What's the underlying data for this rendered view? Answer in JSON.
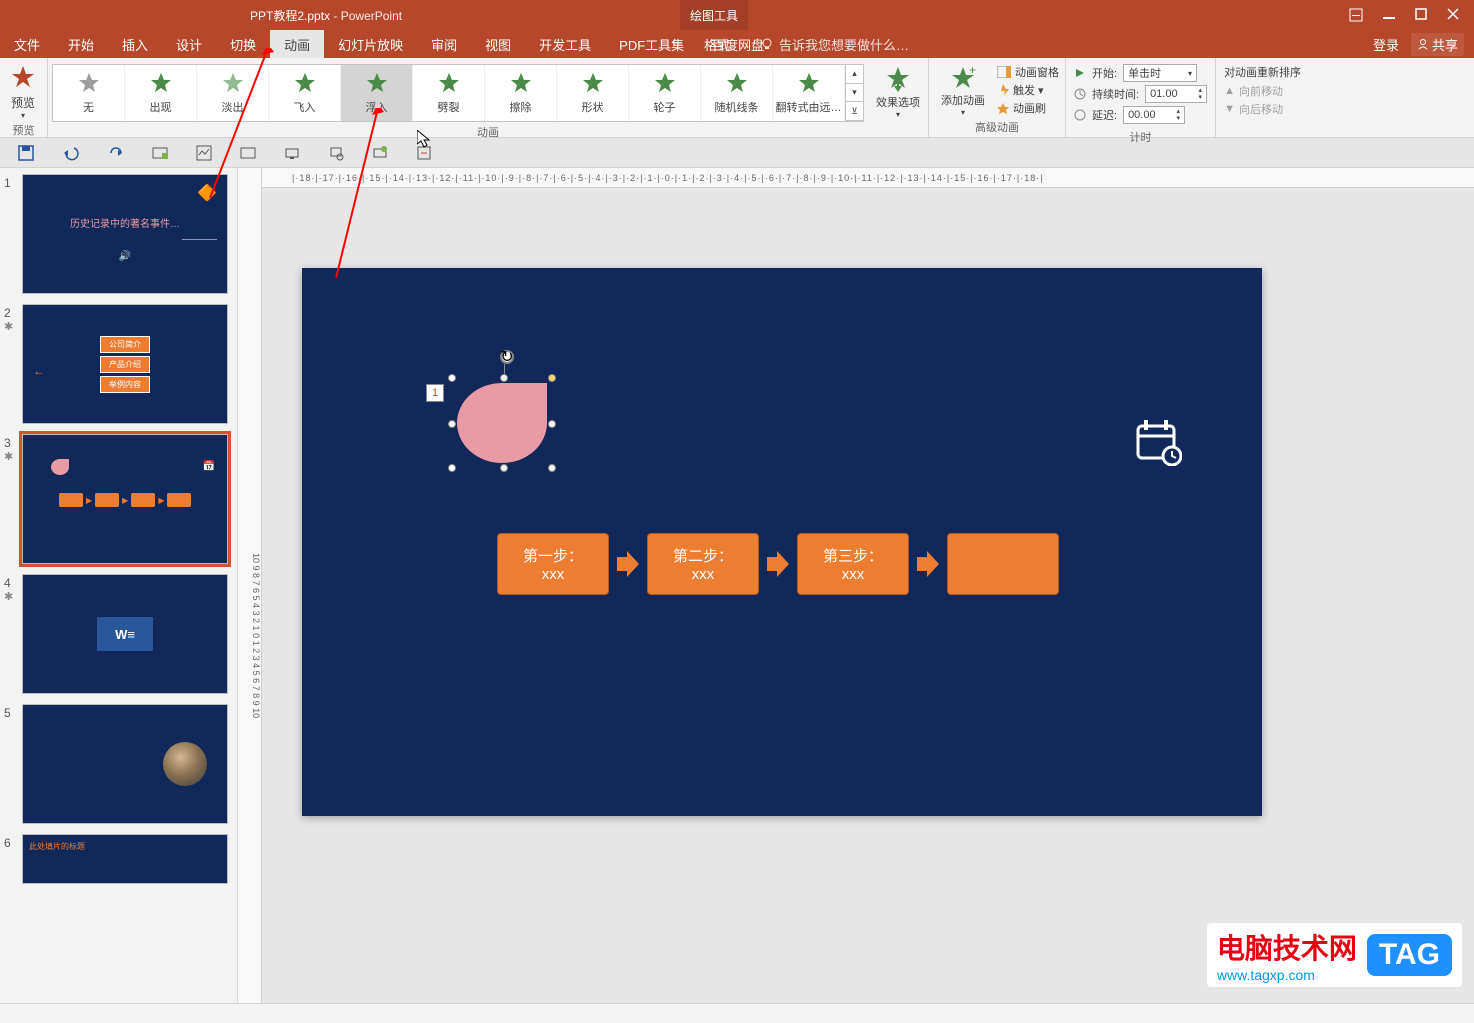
{
  "title": {
    "doc": "PPT教程2.pptx",
    "app": "PowerPoint",
    "drawing_tools": "绘图工具"
  },
  "win": {
    "login": "登录",
    "share": "共享"
  },
  "tabs": {
    "file": "文件",
    "home": "开始",
    "insert": "插入",
    "design": "设计",
    "transition": "切换",
    "animation": "动画",
    "slideshow": "幻灯片放映",
    "review": "审阅",
    "view": "视图",
    "developer": "开发工具",
    "pdf": "PDF工具集",
    "baidu": "百度网盘",
    "format": "格式",
    "tellme": "告诉我您想要做什么…"
  },
  "ribbon": {
    "preview": "预览",
    "preview_group": "预览",
    "anim_group": "动画",
    "anims": {
      "none": "无",
      "appear": "出现",
      "fade": "淡出",
      "flyin": "飞入",
      "floatin": "浮入",
      "split": "劈裂",
      "wipe": "擦除",
      "shape": "形状",
      "wheel": "轮子",
      "random": "随机线条",
      "flip": "翻转式由远…"
    },
    "effect_options": "效果选项",
    "adv_group": "高级动画",
    "add_anim": "添加动画",
    "anim_pane": "动画窗格",
    "trigger": "触发 ▾",
    "painter": "动画刷",
    "timing_group": "计时",
    "start_lbl": "开始:",
    "start_val": "单击时",
    "duration_lbl": "持续时间:",
    "duration_val": "01.00",
    "delay_lbl": "延迟:",
    "delay_val": "00.00",
    "reorder_hdr": "对动画重新排序",
    "move_earlier": "向前移动",
    "move_later": "向后移动"
  },
  "hruler": "|·18·|·17·|·16·|·15·|·14·|·13·|·12·|·11·|·10·|·9·|·8·|·7·|·6·|·5·|·4·|·3·|·2·|·1·|·0·|·1·|·2·|·3·|·4·|·5·|·6·|·7·|·8·|·9·|·10·|·11·|·12·|·13·|·14·|·15·|·16·|·17·|·18·|",
  "slide": {
    "anim_tag": "1",
    "steps": [
      {
        "title": "第一步：",
        "sub": "xxx"
      },
      {
        "title": "第二步：",
        "sub": "xxx"
      },
      {
        "title": "第三步：",
        "sub": "xxx"
      },
      {
        "title": "",
        "sub": ""
      }
    ]
  },
  "thumbs": {
    "t1": {
      "n": "1",
      "l1": "历史记录中的著名事件…"
    },
    "t2": {
      "n": "2",
      "a": "公司简介",
      "b": "产品介绍",
      "c": "举例内容"
    },
    "t3": {
      "n": "3"
    },
    "t4": {
      "n": "4"
    },
    "t5": {
      "n": "5"
    },
    "t6": {
      "n": "6",
      "title": "此处填片的标题"
    }
  },
  "watermark": {
    "txt1": "电脑技术网",
    "txt2": "www.tagxp.com",
    "tag": "TAG"
  }
}
